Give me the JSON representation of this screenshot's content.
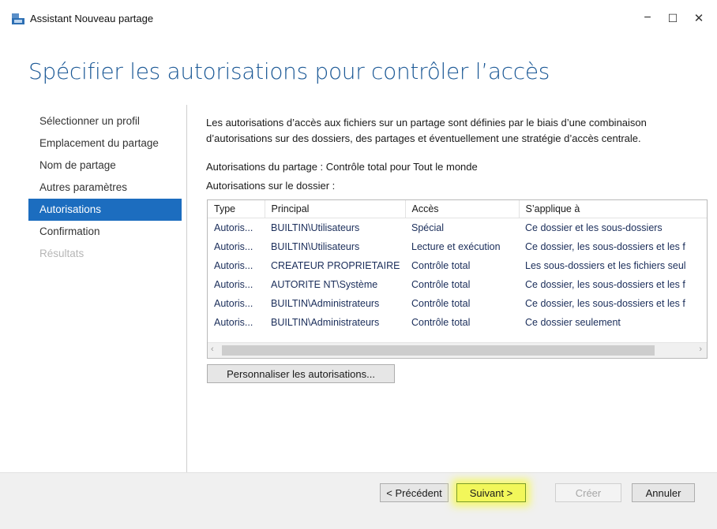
{
  "window": {
    "title": "Assistant Nouveau partage",
    "minimize_glyph": "−",
    "maximize_glyph": "☐",
    "close_glyph": "✕"
  },
  "page_title": "Spécifier les autorisations pour contrôler l’accès",
  "sidebar": {
    "items": [
      {
        "label": "Sélectionner un profil",
        "state": "normal"
      },
      {
        "label": "Emplacement du partage",
        "state": "normal"
      },
      {
        "label": "Nom de partage",
        "state": "normal"
      },
      {
        "label": "Autres paramètres",
        "state": "normal"
      },
      {
        "label": "Autorisations",
        "state": "active"
      },
      {
        "label": "Confirmation",
        "state": "normal"
      },
      {
        "label": "Résultats",
        "state": "disabled"
      }
    ]
  },
  "content": {
    "description_line1": "Les autorisations d’accès aux fichiers sur un partage sont définies par le biais d’une combinaison",
    "description_line2": "d’autorisations sur des dossiers, des partages et éventuellement une stratégie d’accès centrale.",
    "share_permissions": "Autorisations du partage : Contrôle total pour Tout le monde",
    "folder_permissions_label": "Autorisations sur le dossier :"
  },
  "table": {
    "columns": [
      "Type",
      "Principal",
      "Accès",
      "S’applique à"
    ],
    "rows": [
      [
        "Autoris...",
        "BUILTIN\\Utilisateurs",
        "Spécial",
        "Ce dossier et les sous-dossiers"
      ],
      [
        "Autoris...",
        "BUILTIN\\Utilisateurs",
        "Lecture et exécution",
        "Ce dossier, les sous-dossiers et les f"
      ],
      [
        "Autoris...",
        "CREATEUR PROPRIETAIRE",
        "Contrôle total",
        "Les sous-dossiers et les fichiers seul"
      ],
      [
        "Autoris...",
        "AUTORITE NT\\Système",
        "Contrôle total",
        "Ce dossier, les sous-dossiers et les f"
      ],
      [
        "Autoris...",
        "BUILTIN\\Administrateurs",
        "Contrôle total",
        "Ce dossier, les sous-dossiers et les f"
      ],
      [
        "Autoris...",
        "BUILTIN\\Administrateurs",
        "Contrôle total",
        "Ce dossier seulement"
      ]
    ],
    "scroll_left_glyph": "‹",
    "scroll_right_glyph": "›"
  },
  "buttons": {
    "customize": "Personnaliser les autorisations...",
    "previous": "< Précédent",
    "next": "Suivant >",
    "create": "Créer",
    "cancel": "Annuler"
  },
  "colors": {
    "accent": "#1c6dbf",
    "title": "#1c5996",
    "highlight": "#f2f75a"
  }
}
